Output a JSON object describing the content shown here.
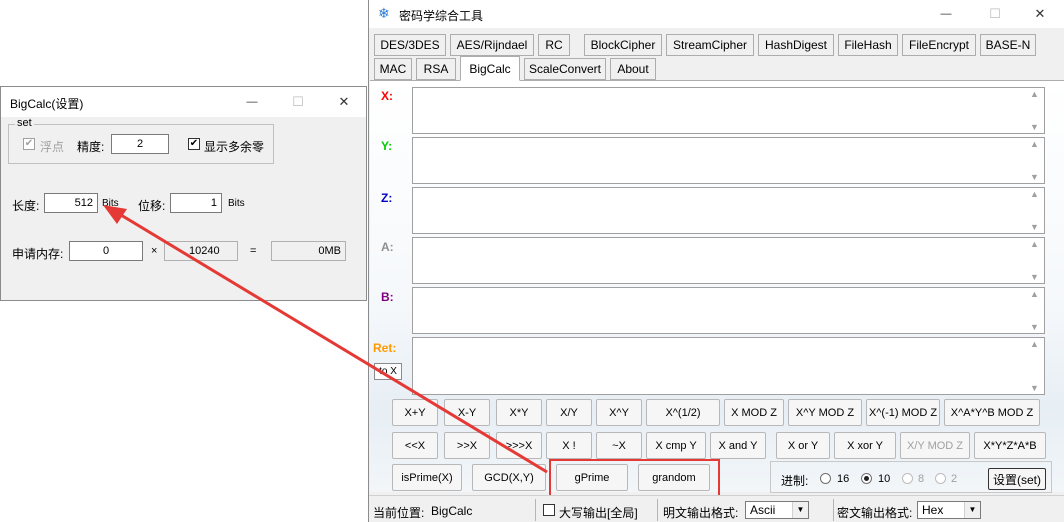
{
  "main": {
    "title": "密码学综合工具",
    "tabs_row1": [
      "DES/3DES",
      "AES/Rijndael",
      "RC",
      "BlockCipher",
      "StreamCipher",
      "HashDigest",
      "FileHash",
      "FileEncrypt",
      "BASE-N"
    ],
    "tabs_row2": [
      "MAC",
      "RSA",
      "BigCalc",
      "ScaleConvert",
      "About"
    ],
    "active_tab": "BigCalc",
    "registers": [
      {
        "label": "X:",
        "color": "#ff0000"
      },
      {
        "label": "Y:",
        "color": "#00cc00"
      },
      {
        "label": "Z:",
        "color": "#0000cc"
      },
      {
        "label": "A:",
        "color": "#909090"
      },
      {
        "label": "B:",
        "color": "#800080"
      },
      {
        "label": "Ret:",
        "color": "#ff9900"
      }
    ],
    "to_x_label": "to X",
    "buttons_row1": [
      "X+Y",
      "X-Y",
      "X*Y",
      "X/Y",
      "X^Y",
      "X^(1/2)",
      "X MOD Z",
      "X^Y MOD Z",
      "X^(-1) MOD Z",
      "X^A*Y^B MOD Z"
    ],
    "buttons_row2": [
      "<<X",
      ">>X",
      ">>>X",
      "X !",
      "~X",
      "X cmp Y",
      "X and Y",
      "X or Y",
      "X xor Y",
      "X/Y MOD Z",
      "X*Y*Z*A*B"
    ],
    "buttons_row3": [
      "isPrime(X)",
      "GCD(X,Y)",
      "gPrime",
      "grandom"
    ],
    "radix_label": "进制:",
    "radix_options": [
      "16",
      "10",
      "8",
      "2"
    ],
    "radix_selected": "10",
    "settings_button": "设置(set)",
    "status": {
      "location_label": "当前位置:",
      "location_value": "BigCalc",
      "uppercase_label": "大写输出[全局]",
      "uppercase_checked": false,
      "plain_format_label": "明文输出格式:",
      "plain_format_value": "Ascii",
      "cipher_format_label": "密文输出格式:",
      "cipher_format_value": "Hex"
    }
  },
  "dialog": {
    "title": "BigCalc(设置)",
    "group_label": "set",
    "float_label": "浮点",
    "float_checked": true,
    "precision_label": "精度:",
    "precision_value": "2",
    "show_zeros_label": "显示多余零",
    "show_zeros_checked": true,
    "length_label": "长度:",
    "length_value": "512",
    "length_unit": "Bits",
    "shift_label": "位移:",
    "shift_value": "1",
    "shift_unit": "Bits",
    "memory_label": "申请内存:",
    "memory_value": "0",
    "times_symbol": "×",
    "memory_factor": "10240",
    "equals_symbol": "=",
    "memory_result": "0MB"
  },
  "window_controls": {
    "minimize": "—",
    "maximize": "☐",
    "close": "✕"
  },
  "colors": {
    "highlight": "#e53935",
    "arrow": "#e53935"
  }
}
